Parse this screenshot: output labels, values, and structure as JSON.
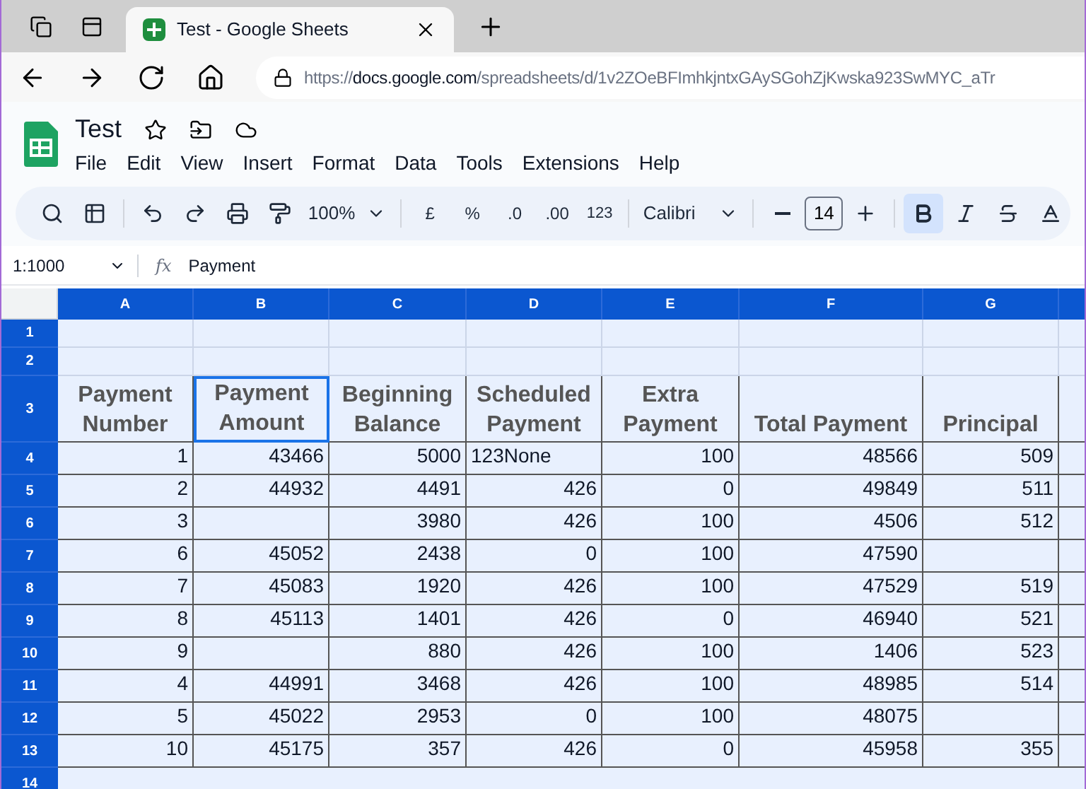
{
  "browser": {
    "tab_title": "Test - Google Sheets",
    "url": {
      "scheme": "https://",
      "host": "docs.google.com",
      "path": "/spreadsheets/d/1v2ZOeBFImhkjntxGAySGohZjKwska923SwMYC_aTr"
    }
  },
  "doc": {
    "title": "Test",
    "menu": [
      "File",
      "Edit",
      "View",
      "Insert",
      "Format",
      "Data",
      "Tools",
      "Extensions",
      "Help"
    ]
  },
  "toolbar": {
    "zoom": "100%",
    "currency": "£",
    "percent": "%",
    "decrease_decimals": ".0",
    "increase_decimals": ".00",
    "number_format": "123",
    "font": "Calibri",
    "font_size": "14",
    "bold": {
      "selected": true
    },
    "italic": {
      "selected": false
    },
    "strikethrough": {
      "selected": false
    }
  },
  "formula_bar": {
    "name_box": "1:1000",
    "fx_label": "fx",
    "formula": "Payment"
  },
  "columns": [
    "A",
    "B",
    "C",
    "D",
    "E",
    "F",
    "G"
  ],
  "header_row": {
    "number": "3",
    "cells": [
      {
        "text": "Payment Number",
        "selected": false
      },
      {
        "text": "Payment Amount",
        "selected": true
      },
      {
        "text": "Beginning Balance",
        "selected": false
      },
      {
        "text": "Scheduled Payment",
        "selected": false
      },
      {
        "text": "Extra Payment",
        "selected": false
      },
      {
        "text": "Total Payment",
        "selected": false
      },
      {
        "text": "Principal",
        "selected": false
      }
    ]
  },
  "empty_rows": [
    "1",
    "2"
  ],
  "rows": [
    {
      "number": "4",
      "cells": [
        "1",
        "43466",
        "5000",
        "123None",
        "100",
        "48566",
        "509"
      ]
    },
    {
      "number": "5",
      "cells": [
        "2",
        "44932",
        "4491",
        "426",
        "0",
        "49849",
        "511"
      ]
    },
    {
      "number": "6",
      "cells": [
        "3",
        null,
        "3980",
        "426",
        "100",
        "4506",
        "512"
      ]
    },
    {
      "number": "7",
      "cells": [
        "6",
        "45052",
        "2438",
        "0",
        "100",
        "47590",
        null
      ]
    },
    {
      "number": "8",
      "cells": [
        "7",
        "45083",
        "1920",
        "426",
        "100",
        "47529",
        "519"
      ]
    },
    {
      "number": "9",
      "cells": [
        "8",
        "45113",
        "1401",
        "426",
        "0",
        "46940",
        "521"
      ]
    },
    {
      "number": "10",
      "cells": [
        "9",
        null,
        "880",
        "426",
        "100",
        "1406",
        "523"
      ]
    },
    {
      "number": "11",
      "cells": [
        "4",
        "44991",
        "3468",
        "426",
        "100",
        "48985",
        "514"
      ]
    },
    {
      "number": "12",
      "cells": [
        "5",
        "45022",
        "2953",
        "0",
        "100",
        "48075",
        null
      ]
    },
    {
      "number": "13",
      "cells": [
        "10",
        "45175",
        "357",
        "426",
        "0",
        "45958",
        "355"
      ]
    }
  ],
  "partial_row": "14"
}
